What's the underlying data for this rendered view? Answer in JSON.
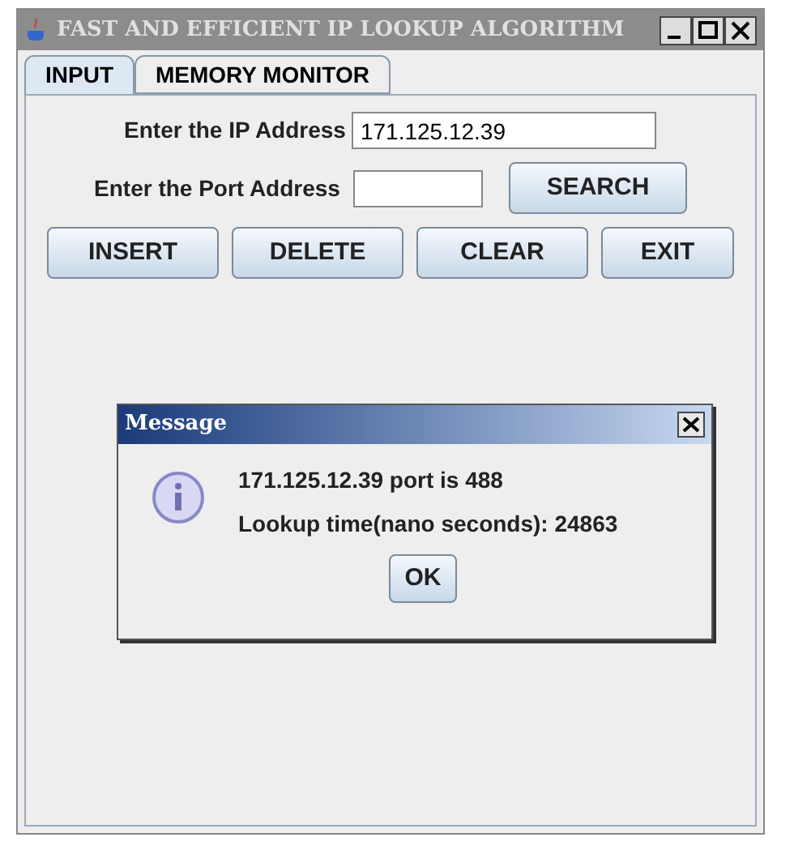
{
  "window": {
    "title": "FAST AND EFFICIENT IP LOOKUP ALGORITHM"
  },
  "tabs": [
    {
      "label": "INPUT",
      "selected": true
    },
    {
      "label": "MEMORY MONITOR",
      "selected": false
    }
  ],
  "ip_field": {
    "label": "Enter the IP Address",
    "value": "171.125.12.39"
  },
  "port_field": {
    "label": "Enter the Port Address"
  },
  "search_button": "SEARCH",
  "buttons": [
    "INSERT",
    "DELETE",
    "CLEAR",
    "EXIT"
  ],
  "dialog": {
    "title": "Message",
    "lines": [
      "171.125.12.39 port is 488",
      "Lookup time(nano seconds): 24863"
    ],
    "button": "OK"
  }
}
